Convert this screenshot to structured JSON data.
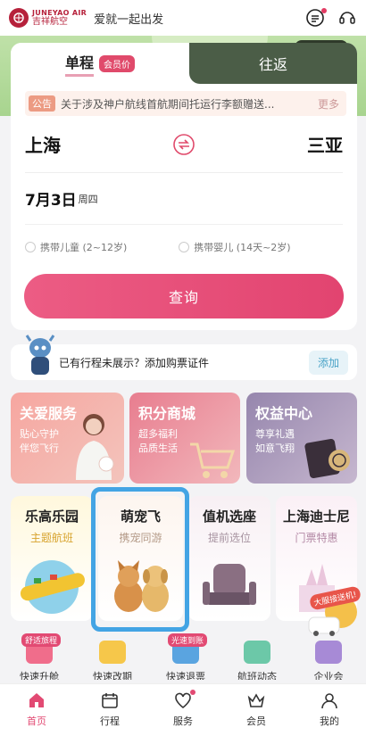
{
  "header": {
    "logo_en": "JUNEYAO AIR",
    "logo_cn": "吉祥航空",
    "slogan": "爱就一起出发",
    "icons": [
      "message-icon",
      "customer-service-icon"
    ]
  },
  "search": {
    "tabs": {
      "one_way": "单程",
      "member_badge": "会员价",
      "round_trip": "往返"
    },
    "notice": {
      "tag": "公告",
      "text": "关于涉及神户航线首航期间托运行李额赠送...",
      "more": "更多"
    },
    "from_city": "上海",
    "to_city": "三亚",
    "date": "7月3日",
    "weekday": "周四",
    "child_option": "携带儿童 (2~12岁)",
    "infant_option": "携带婴儿 (14天~2岁)",
    "search_label": "查询"
  },
  "trip": {
    "text": "已有行程未展示？添加购票证件",
    "add_label": "添加"
  },
  "services": [
    {
      "title": "关爱服务",
      "sub1": "贴心守护",
      "sub2": "伴您飞行"
    },
    {
      "title": "积分商城",
      "sub1": "超多福利",
      "sub2": "品质生活"
    },
    {
      "title": "权益中心",
      "sub1": "尊享礼遇",
      "sub2": "如意飞翔"
    }
  ],
  "features": [
    {
      "title": "乐高乐园",
      "sub": "主题航班"
    },
    {
      "title": "萌宠飞",
      "sub": "携宠同游"
    },
    {
      "title": "值机选座",
      "sub": "提前选位"
    },
    {
      "title": "上海迪士尼",
      "sub": "门票特惠"
    }
  ],
  "float_label": "大服接送机!",
  "quick": [
    {
      "label": "快速升舱",
      "tag": "舒适旅程"
    },
    {
      "label": "快速改期",
      "tag": ""
    },
    {
      "label": "快速退票",
      "tag": "光速到账"
    },
    {
      "label": "航班动态",
      "tag": ""
    },
    {
      "label": "企业会",
      "tag": ""
    }
  ],
  "nav": [
    {
      "label": "首页",
      "icon": "home-icon"
    },
    {
      "label": "行程",
      "icon": "calendar-icon"
    },
    {
      "label": "服务",
      "icon": "heart-icon"
    },
    {
      "label": "会员",
      "icon": "crown-icon"
    },
    {
      "label": "我的",
      "icon": "profile-icon"
    }
  ],
  "colors": {
    "brand": "#b6213b",
    "accent_pink": "#e24a73",
    "highlight_blue": "#43a4e4",
    "tab_dark": "#4b5d47"
  }
}
